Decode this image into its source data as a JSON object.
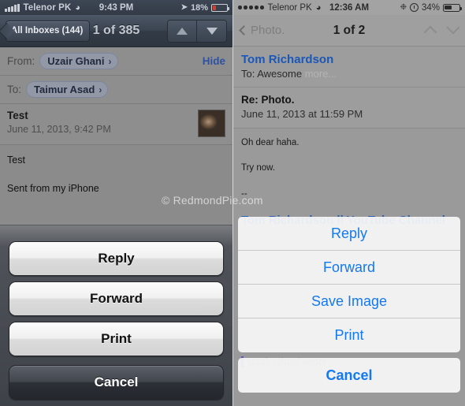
{
  "left_phone": {
    "status_bar": {
      "signal_icon": "signal-bars-icon",
      "carrier": "Telenor PK",
      "wifi_icon": "wifi-icon",
      "time": "9:43 PM",
      "location_icon": "location-arrow-icon",
      "battery_percent": "18%",
      "battery_icon": "battery-low-icon",
      "battery_color": "#d1402f"
    },
    "nav_bar": {
      "back_label": "All Inboxes (144)",
      "title": "1 of 385",
      "prev_icon": "triangle-up-icon",
      "next_icon": "triangle-down-icon"
    },
    "from_row": {
      "label": "From:",
      "value": "Uzair Ghani",
      "chevron": "›",
      "hide_label": "Hide"
    },
    "to_row": {
      "label": "To:",
      "value": "Taimur Asad",
      "chevron": "›"
    },
    "subject": {
      "title": "Test",
      "date": "June 11, 2013, 9:42 PM",
      "avatar_icon": "contact-photo-icon"
    },
    "body": {
      "line1": "Test",
      "line2": "Sent from my iPhone"
    },
    "action_sheet": {
      "buttons": [
        {
          "label": "Reply",
          "style": "light"
        },
        {
          "label": "Forward",
          "style": "light"
        },
        {
          "label": "Print",
          "style": "light"
        }
      ],
      "cancel_label": "Cancel"
    }
  },
  "right_phone": {
    "status_bar": {
      "signal_icon": "signal-dots-icon",
      "carrier": "Telenor PK",
      "wifi_icon": "wifi-icon",
      "time": "12:36 AM",
      "sync_icon": "sync-spinner-icon",
      "orientation_lock_icon": "rotation-lock-icon",
      "battery_percent": "34%",
      "battery_icon": "battery-icon"
    },
    "nav_bar": {
      "back_icon": "chevron-left-icon",
      "back_label": "Photo.",
      "title": "1 of 2",
      "prev_icon": "chevron-up-icon",
      "next_icon": "chevron-down-icon"
    },
    "header": {
      "sender": "Tom Richardson",
      "to_prefix": "To: Awesome",
      "more_label": "more..."
    },
    "subject": {
      "title": "Re: Photo.",
      "date": "June 11, 2013 at 11:59 PM"
    },
    "body": {
      "line1": "Oh dear haha.",
      "line2": "Try now.",
      "line3": "--",
      "signature": "Tom Richardson ll YouTube Channel",
      "quote": "Uzair Ghani wrote:"
    },
    "action_sheet": {
      "buttons": [
        {
          "label": "Reply"
        },
        {
          "label": "Forward"
        },
        {
          "label": "Save Image"
        },
        {
          "label": "Print"
        }
      ],
      "cancel_label": "Cancel"
    }
  },
  "watermark": {
    "text": "© RedmondPie.com"
  },
  "colors": {
    "ios7_blue": "#1478f0",
    "ios6_link_blue": "#2f52a0",
    "sender_blue": "#1b57b8"
  }
}
